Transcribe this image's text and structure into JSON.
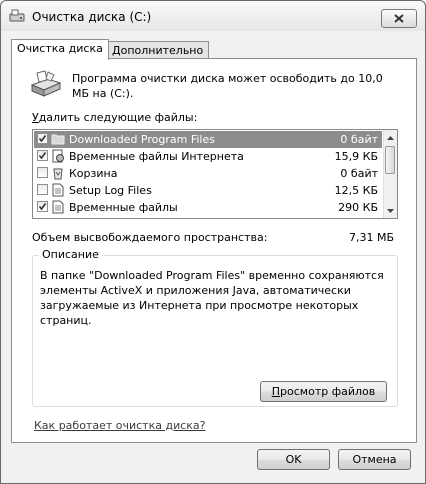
{
  "window": {
    "title": "Очистка диска  (C:)"
  },
  "tabs": [
    {
      "label": "Очистка диска",
      "active": true
    },
    {
      "label": "Дополнительно",
      "active": false
    }
  ],
  "intro_text": "Программа очистки диска может освободить до 10,0 МБ на (C:).",
  "list_label_accel": "У",
  "list_label_rest": "далить следующие файлы:",
  "files": [
    {
      "name": "Downloaded Program Files",
      "size": "0 байт",
      "checked": true,
      "selected": true,
      "icon": "folder-icon"
    },
    {
      "name": "Временные файлы Интернета",
      "size": "15,9 КБ",
      "checked": true,
      "selected": false,
      "icon": "internet-files-icon"
    },
    {
      "name": "Корзина",
      "size": "0 байт",
      "checked": false,
      "selected": false,
      "icon": "recycle-bin-icon"
    },
    {
      "name": "Setup Log Files",
      "size": "12,5 КБ",
      "checked": false,
      "selected": false,
      "icon": "document-icon"
    },
    {
      "name": "Временные файлы",
      "size": "290 КБ",
      "checked": true,
      "selected": false,
      "icon": "document-icon"
    }
  ],
  "space_label": "Объем высвобождаемого пространства:",
  "space_value": "7,31 МБ",
  "description": {
    "legend": "Описание",
    "text": "В папке \"Downloaded Program Files\" временно сохраняются элементы ActiveX и приложения Java, автоматически загружаемые из Интернета при просмотре некоторых страниц."
  },
  "buttons": {
    "view_files_accel": "П",
    "view_files_rest": "росмотр файлов",
    "ok": "OK",
    "cancel": "Отмена"
  },
  "help_link": "Как работает очистка диска?"
}
